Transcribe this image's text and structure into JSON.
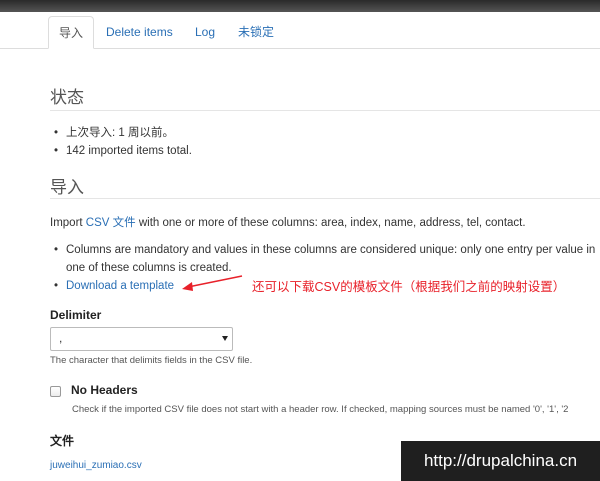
{
  "tabs": [
    {
      "label": "导入",
      "active": true
    },
    {
      "label": "Delete items",
      "active": false
    },
    {
      "label": "Log",
      "active": false
    },
    {
      "label": "未锁定",
      "active": false
    }
  ],
  "status": {
    "heading": "状态",
    "items": [
      "上次导入: 1 周以前。",
      "142 imported items total."
    ]
  },
  "import": {
    "heading": "导入",
    "intro_prefix": "Import ",
    "intro_link": "CSV 文件",
    "intro_suffix": " with one or more of these columns: area, index, name, address, tel, contact.",
    "bullet_unique": "Columns are mandatory and values in these columns are considered unique: only one entry per value in one of these columns is created.",
    "download_link": "Download a template"
  },
  "annotation": "还可以下载CSV的模板文件（根据我们之前的映射设置）",
  "delimiter": {
    "label": "Delimiter",
    "value": ",",
    "help": "The character that delimits fields in the CSV file."
  },
  "no_headers": {
    "label": "No Headers",
    "checked": false,
    "help": "Check if the imported CSV file does not start with a header row. If checked, mapping sources must be named '0', '1', '2"
  },
  "file": {
    "label": "文件",
    "name": "juweihui_zumiao.csv"
  },
  "watermark": "http://drupalchina.cn",
  "colors": {
    "link": "#2a6fb5",
    "annotation": "#e8212a",
    "watermark_bg": "#1f1f1f"
  }
}
